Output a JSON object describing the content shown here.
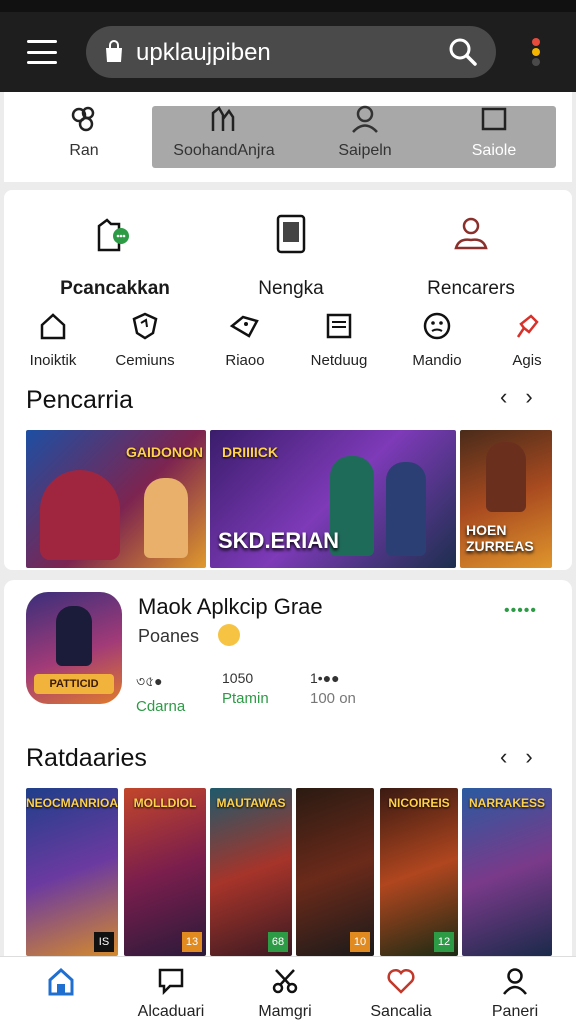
{
  "search": {
    "value": "upklaujpiben"
  },
  "tabs": [
    {
      "label": "Ran"
    },
    {
      "label": "SoohandAnjra"
    },
    {
      "label": "Saipeln"
    },
    {
      "label": "Saiole"
    }
  ],
  "features": [
    {
      "label": "Pcancakkan"
    },
    {
      "label": "Nengka"
    },
    {
      "label": "Rencarers"
    }
  ],
  "categories": [
    {
      "label": "Inoiktik"
    },
    {
      "label": "Cemiuns"
    },
    {
      "label": "Riaoo"
    },
    {
      "label": "Netduug"
    },
    {
      "label": "Mandio"
    },
    {
      "label": "Agis"
    }
  ],
  "section1": {
    "title": "Pencarria",
    "prev": "‹",
    "next": "›"
  },
  "banners": [
    {
      "tag": "GAIDONON",
      "caption": ""
    },
    {
      "tag": "DRIIIICK",
      "caption": "SKD.ERIAN"
    },
    {
      "tag": "",
      "caption": "HOEN ZURREAS"
    }
  ],
  "app": {
    "name": "Maok Aplkcip Grae",
    "subtitle": "Poanes",
    "more": "•••••",
    "icon_text": "PATTICID",
    "stats": [
      {
        "value": "৩৫●",
        "label": "Cdarna"
      },
      {
        "value": "1050",
        "label": "Ptamin"
      },
      {
        "value": "1•●●",
        "label": "100 on"
      }
    ]
  },
  "section2": {
    "title": "Ratdaaries",
    "prev": "‹",
    "next": "›"
  },
  "thumbs": [
    {
      "title": "NEOCMANRIOAL",
      "badge": "IS"
    },
    {
      "title": "MOLLDIOL",
      "badge": "13"
    },
    {
      "title": "MAUTAWAS",
      "badge": "68"
    },
    {
      "title": "",
      "badge": "10"
    },
    {
      "title": "NICOIREIS",
      "badge": "12"
    },
    {
      "title": "NARRAKESS",
      "badge": ""
    }
  ],
  "bottom_nav": [
    {
      "label": ""
    },
    {
      "label": "Alcaduari"
    },
    {
      "label": "Mamgri"
    },
    {
      "label": "Sancalia"
    },
    {
      "label": "Paneri"
    }
  ],
  "colors": {
    "accent_green": "#2d9b45",
    "appbar": "#1e1e1e",
    "nav_active": "#1f6fd1",
    "heart": "#c0392b"
  }
}
